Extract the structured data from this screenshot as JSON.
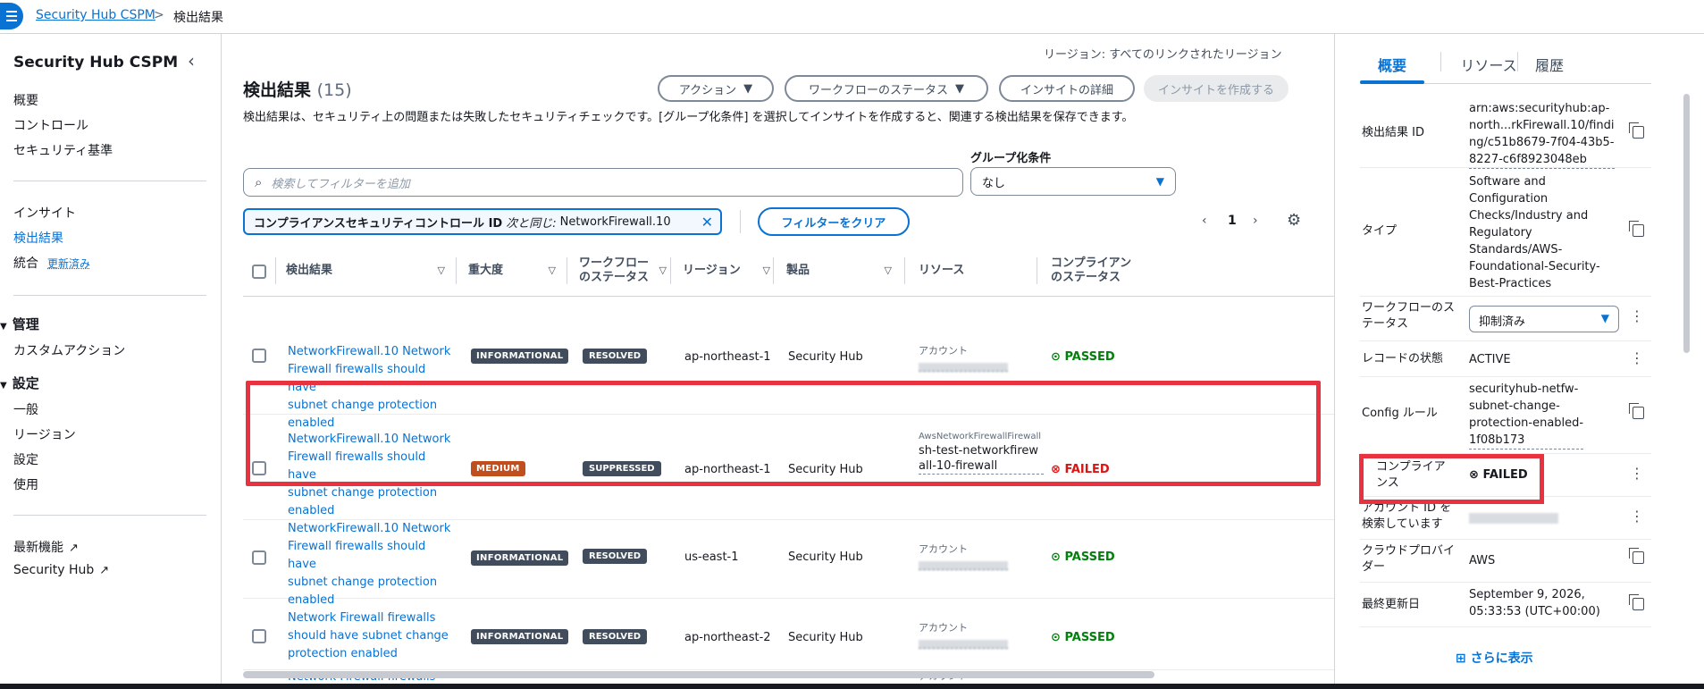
{
  "breadcrumb": {
    "root": "Security Hub CSPM",
    "sep": ">",
    "current": "検出結果"
  },
  "sidebar": {
    "title": "Security Hub CSPM",
    "group1": [
      "概要",
      "コントロール",
      "セキュリティ基準"
    ],
    "group2": {
      "insights": "インサイト",
      "findings": "検出結果",
      "integrations": "統合",
      "updated": "更新済み"
    },
    "mgmt": {
      "title": "管理",
      "items": [
        "カスタムアクション"
      ]
    },
    "settings": {
      "title": "設定",
      "items": [
        "一般",
        "リージョン",
        "設定",
        "使用"
      ]
    },
    "footer": {
      "whats_new": "最新機能",
      "security_hub": "Security Hub"
    }
  },
  "main": {
    "region": "リージョン: すべてのリンクされたリージョン",
    "title": "検出結果",
    "count": "(15)",
    "buttons": {
      "action": "アクション",
      "workflow": "ワークフローのステータス",
      "insight_details": "インサイトの詳細",
      "create_insight": "インサイトを作成する"
    },
    "description": "検出結果は、セキュリティ上の問題または失敗したセキュリティチェックです。[グループ化条件] を選択してインサイトを作成すると、関連する検出結果を保存できます。",
    "search_placeholder": "検索してフィルターを追加",
    "group_by": {
      "label": "グループ化条件",
      "value": "なし"
    },
    "filter": {
      "key": "コンプライアンスセキュリティコントロール ID",
      "op": "次と同じ:",
      "value": "NetworkFirewall.10"
    },
    "clear_filter": "フィルターをクリア",
    "page": "1",
    "columns": {
      "finding": "検出結果",
      "severity": "重大度",
      "workflow1": "ワークフロー",
      "workflow2": "のステータス",
      "region": "リージョン",
      "product": "製品",
      "resource": "リソース",
      "compliance1": "コンプライアン",
      "compliance2": "のステータス"
    }
  },
  "rows": [
    {
      "title": [
        "NetworkFirewall.10 Network",
        "Firewall firewalls should have",
        "subnet change protection",
        "enabled"
      ],
      "severity": "INFORMATIONAL",
      "workflow": "RESOLVED",
      "region": "ap-northeast-1",
      "product": "Security Hub",
      "resource_label": "アカウント",
      "resource": "",
      "status": "PASSED"
    },
    {
      "title": [
        "NetworkFirewall.10 Network",
        "Firewall firewalls should have",
        "subnet change protection",
        "enabled"
      ],
      "severity": "MEDIUM",
      "workflow": "SUPPRESSED",
      "region": "ap-northeast-1",
      "product": "Security Hub",
      "resource_label": "AwsNetworkFirewallFirewall",
      "resource": "sh-test-networkfirewall-10-firewall",
      "status": "FAILED"
    },
    {
      "title": [
        "NetworkFirewall.10 Network",
        "Firewall firewalls should have",
        "subnet change protection",
        "enabled"
      ],
      "severity": "INFORMATIONAL",
      "workflow": "RESOLVED",
      "region": "us-east-1",
      "product": "Security Hub",
      "resource_label": "アカウント",
      "resource": "",
      "status": "PASSED"
    },
    {
      "title": [
        "Network Firewall firewalls",
        "should have subnet change",
        "protection enabled"
      ],
      "severity": "INFORMATIONAL",
      "workflow": "RESOLVED",
      "region": "ap-northeast-2",
      "product": "Security Hub",
      "resource_label": "アカウント",
      "resource": "",
      "status": "PASSED"
    },
    {
      "title": [
        "Network Firewall firewalls"
      ],
      "severity": "",
      "workflow": "",
      "region": "",
      "product": "",
      "resource_label": "アカウント",
      "resource": "",
      "status": ""
    }
  ],
  "panel": {
    "tabs": [
      "概要",
      "リソース",
      "履歴"
    ],
    "finding_id": {
      "k": "検出結果 ID",
      "v": [
        "arn:aws:securityhub:ap-",
        "north...rkFirewall.10/findi",
        "ng/c51b8679-7f04-43b5-",
        "8227-c6f8923048eb"
      ]
    },
    "type": {
      "k": "タイプ",
      "v": [
        "Software and",
        "Configuration",
        "Checks/Industry and",
        "Regulatory",
        "Standards/AWS-",
        "Foundational-Security-",
        "Best-Practices"
      ]
    },
    "workflow": {
      "k": [
        "ワークフローのス",
        "テータス"
      ],
      "v": "抑制済み"
    },
    "record": {
      "k": "レコードの状態",
      "v": "ACTIVE"
    },
    "config": {
      "k": "Config ルール",
      "v": [
        "securityhub-netfw-",
        "subnet-change-",
        "protection-enabled-",
        "1f08b173"
      ]
    },
    "compliance": {
      "k": [
        "コンプライア",
        "ンス"
      ],
      "v": "FAILED"
    },
    "account": {
      "k": [
        "アカウント ID を",
        "検索しています"
      ]
    },
    "cloud": {
      "k": [
        "クラウドプロバイ",
        "ダー"
      ],
      "v": "AWS"
    },
    "updated": {
      "k": "最終更新日",
      "v": [
        "September 9, 2026,",
        "05:33:53 (UTC+00:00)"
      ]
    },
    "more": "さらに表示"
  }
}
